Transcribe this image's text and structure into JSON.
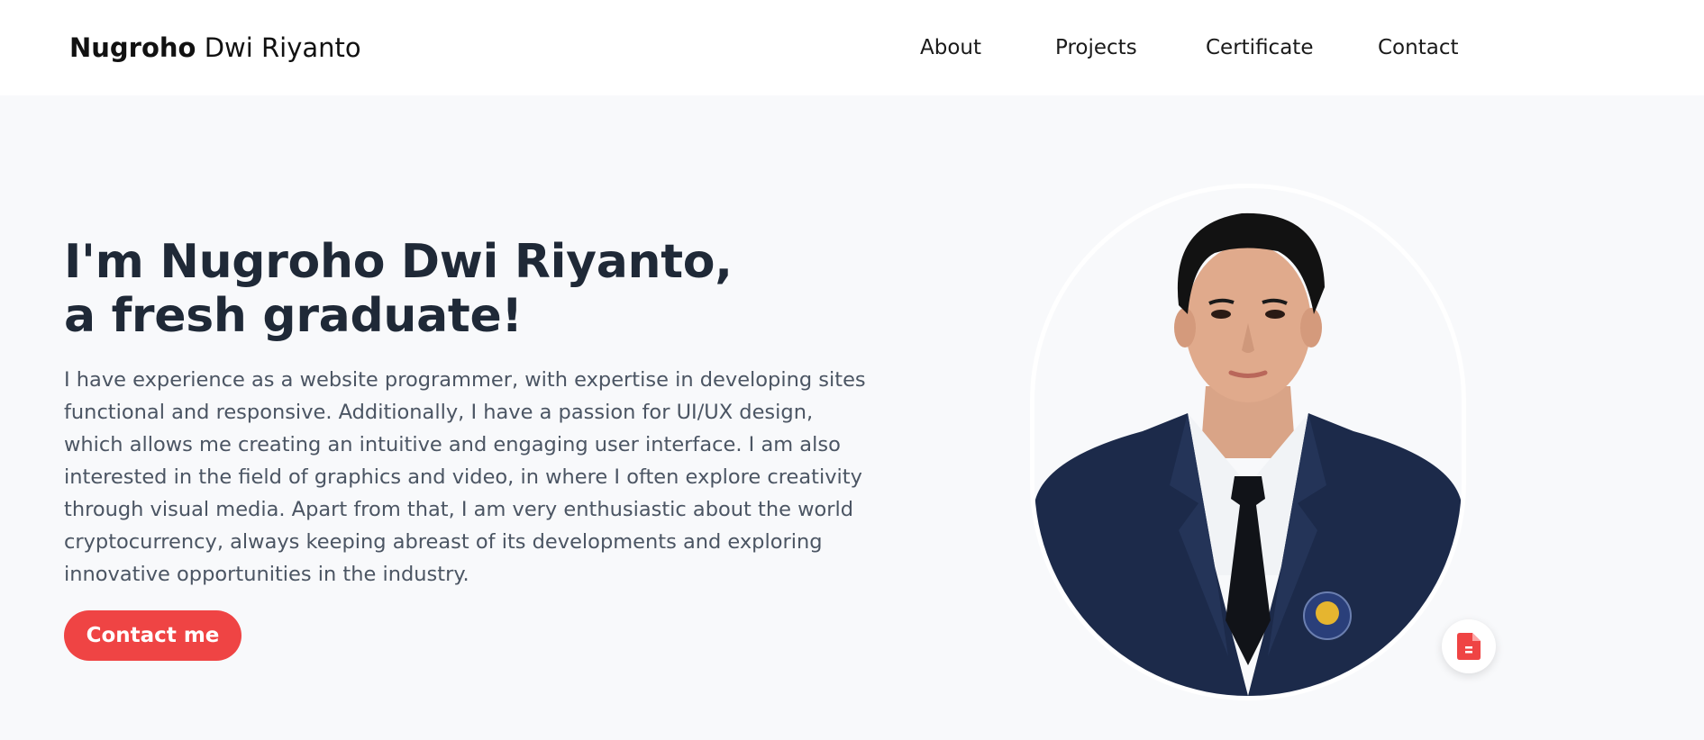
{
  "navbar": {
    "brand_first": "Nugroho",
    "brand_rest": "Dwi Riyanto",
    "links": [
      {
        "label": "About"
      },
      {
        "label": "Projects"
      },
      {
        "label": "Certificate"
      },
      {
        "label": "Contact"
      }
    ]
  },
  "hero": {
    "headline_line1": "I'm Nugroho Dwi Riyanto,",
    "headline_line2": "a fresh graduate!",
    "bio": "I have experience as a website programmer, with expertise in developing sites functional and responsive. Additionally, I have a passion for UI/UX design, which allows me creating an intuitive and engaging user interface. I am also interested in the field of graphics and video, in where I often explore creativity through visual media. Apart from that, I am very enthusiastic about the world cryptocurrency, always keeping abreast of its developments and exploring innovative opportunities in the industry.",
    "cta_label": "Contact me"
  },
  "icons": {
    "profile_photo": "person-portrait",
    "cv_button": "document-icon"
  },
  "colors": {
    "accent": "#ef4444",
    "heading": "#1f2937",
    "body_text": "#4b5563",
    "page_bg": "#f8f9fb",
    "nav_bg": "#ffffff"
  }
}
